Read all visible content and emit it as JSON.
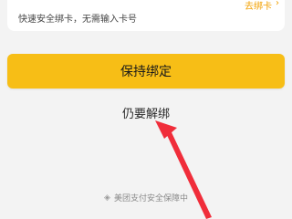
{
  "card": {
    "description": "快速安全绑卡，无需输入卡号",
    "link_label": "去绑卡",
    "link_icon": "chevron-right-icon"
  },
  "actions": {
    "keep_bound_label": "保持绑定",
    "unbind_label": "仍要解绑"
  },
  "footer": {
    "icon": "shield-icon",
    "text": "美团支付安全保障中"
  },
  "colors": {
    "primary_button": "#f7be16",
    "link": "#f2a000",
    "annotation_arrow": "#f02d3a",
    "background": "#f3f3f3"
  }
}
